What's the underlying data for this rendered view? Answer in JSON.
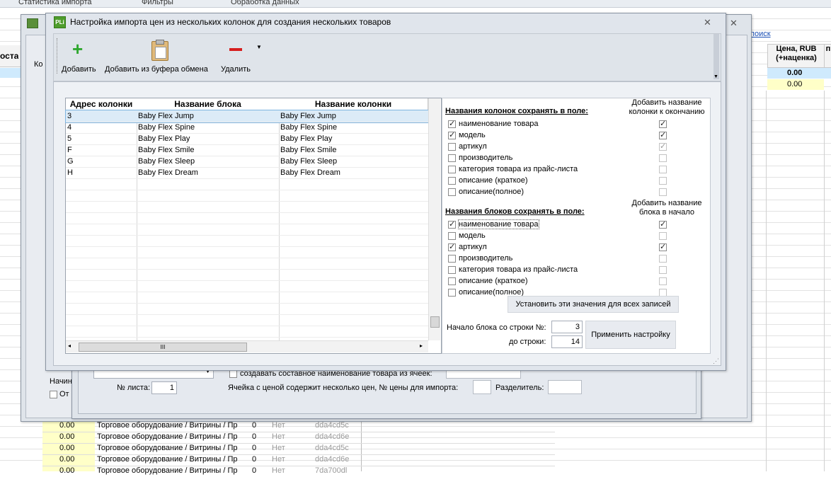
{
  "background": {
    "tabs": [
      "Статистика импорта",
      "Фильтры",
      "Обработка данных"
    ],
    "link_text": "поиск",
    "col_left_partial": "оста",
    "price_header": "Цена, RUB\n(+наценка)",
    "price_header_extra": "п",
    "price_values": [
      "0.00",
      "0.00"
    ],
    "rows": [
      {
        "price": "0.00",
        "category": "Торговое оборудование / Витрины / Пр",
        "qty": "0",
        "flag": "Нет",
        "id": "dda4cd5c"
      },
      {
        "price": "0.00",
        "category": "Торговое оборудование / Витрины / Пр",
        "qty": "0",
        "flag": "Нет",
        "id": "dda4cd6e"
      },
      {
        "price": "0.00",
        "category": "Торговое оборудование / Витрины / Пр",
        "qty": "0",
        "flag": "Нет",
        "id": "dda4cd5c"
      },
      {
        "price": "0.00",
        "category": "Торговое оборудование / Витрины / Пр",
        "qty": "0",
        "flag": "Нет",
        "id": "dda4cd6e"
      },
      {
        "price": "0.00",
        "category": "Торговое оборудование / Витрины / Пр",
        "qty": "0",
        "flag": "Нет",
        "id": "7da700dl"
      }
    ]
  },
  "middle_window": {
    "left_labels": [
      "Ко",
      "Начин",
      "От"
    ],
    "sheet_label": "№ листа:",
    "sheet_value": "1",
    "compound_name_label": "создавать составное наименование товара из ячеек:",
    "multiprice_label": "Ячейка с ценой содержит несколько цен, № цены для импорта:",
    "separator_label": "Разделитель:"
  },
  "dialog": {
    "title": "Настройка импорта цен из нескольких колонок для создания нескольких товаров",
    "icon_text": "PLi",
    "toolbar": {
      "add_label": "Добавить",
      "add_clipboard_label": "Добавить из буфера обмена",
      "delete_label": "Удалить"
    },
    "grid": {
      "headers": [
        "Адрес колонки",
        "Название блока",
        "Название колонки"
      ],
      "rows": [
        [
          "3",
          "Baby Flex Jump",
          "Baby Flex Jump"
        ],
        [
          "4",
          "Baby Flex Spine",
          "Baby Flex Spine"
        ],
        [
          "5",
          "Baby Flex Play",
          "Baby Flex Play"
        ],
        [
          "F",
          "Baby Flex Smile",
          "Baby Flex Smile"
        ],
        [
          "G",
          "Baby Flex Sleep",
          "Baby Flex Sleep"
        ],
        [
          "H",
          "Baby Flex Dream",
          "Baby Flex Dream"
        ]
      ],
      "hscroll_glyph": "III"
    },
    "columns_section": {
      "title": "Названия колонок сохранять в поле:",
      "side_header": "Добавить название\nколонки к окончанию",
      "options": [
        {
          "label": "наименование товара",
          "checked": true,
          "side": true,
          "side_dim": false
        },
        {
          "label": "модель",
          "checked": true,
          "side": true,
          "side_dim": false
        },
        {
          "label": "артикул",
          "checked": false,
          "side": true,
          "side_dim": true
        },
        {
          "label": "производитель",
          "checked": false,
          "side": false,
          "side_dim": true
        },
        {
          "label": "категория товара из прайс-листа",
          "checked": false,
          "side": false,
          "side_dim": true
        },
        {
          "label": "описание (краткое)",
          "checked": false,
          "side": false,
          "side_dim": true
        },
        {
          "label": "описание(полное)",
          "checked": false,
          "side": false,
          "side_dim": true
        }
      ]
    },
    "blocks_section": {
      "title": "Названия блоков сохранять в поле:",
      "side_header": "Добавить название\nблока в начало",
      "options": [
        {
          "label": "наименование товара",
          "checked": true,
          "side": true,
          "side_dim": false
        },
        {
          "label": "модель",
          "checked": false,
          "side": false,
          "side_dim": true
        },
        {
          "label": "артикул",
          "checked": true,
          "side": true,
          "side_dim": false
        },
        {
          "label": "производитель",
          "checked": false,
          "side": false,
          "side_dim": true
        },
        {
          "label": "категория товара из прайс-листа",
          "checked": false,
          "side": false,
          "side_dim": true
        },
        {
          "label": "описание (краткое)",
          "checked": false,
          "side": false,
          "side_dim": true
        },
        {
          "label": "описание(полное)",
          "checked": false,
          "side": false,
          "side_dim": true
        }
      ]
    },
    "set_all_label": "Установить эти значения для всех записей",
    "start_row_label": "Начало блока со строки №:",
    "start_row_value": "3",
    "end_row_label": "до строки:",
    "end_row_value": "14",
    "apply_label": "Применить настройку"
  }
}
